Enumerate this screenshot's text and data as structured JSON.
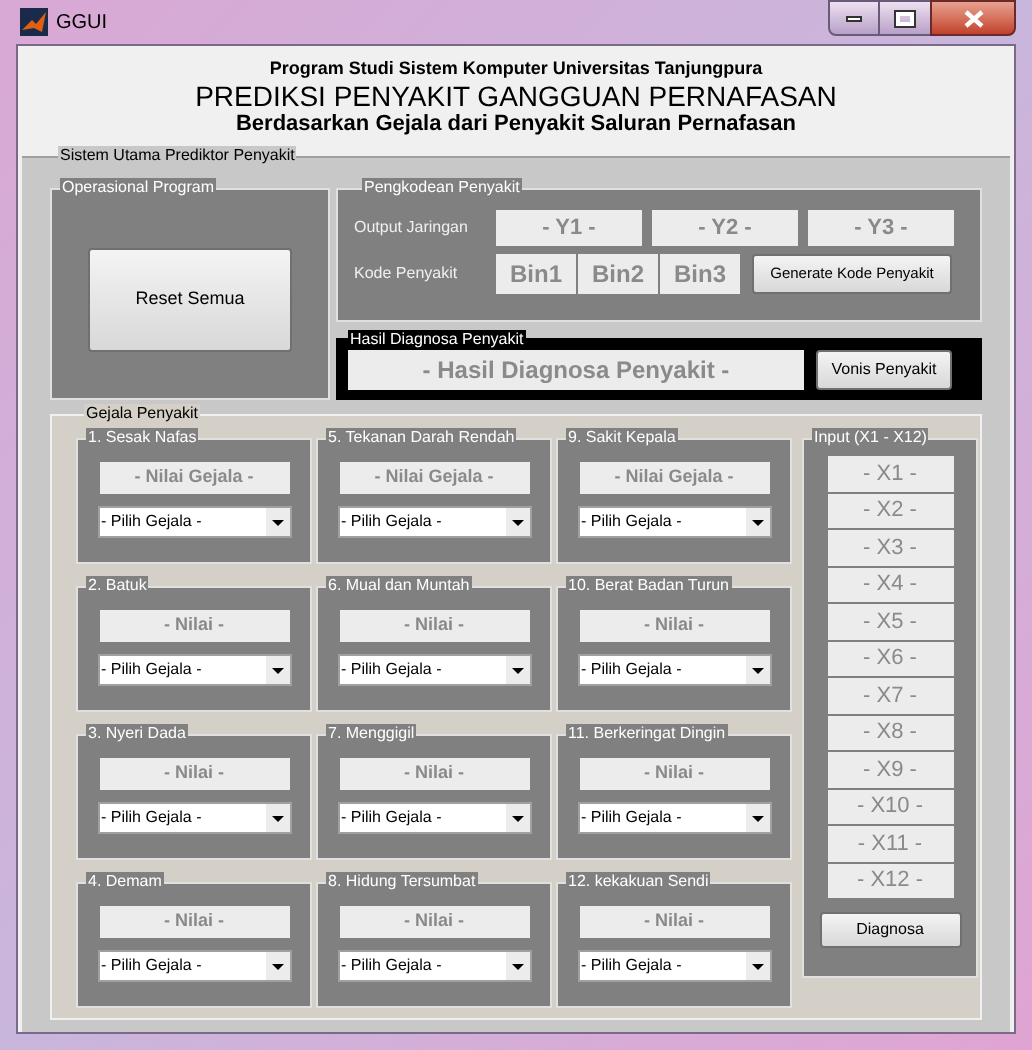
{
  "window": {
    "title": "GGUI"
  },
  "header": {
    "institution": "Program Studi Sistem Komputer Universitas Tanjungpura",
    "title": "PREDIKSI PENYAKIT GANGGUAN PERNAFASAN",
    "subtitle": "Berdasarkan Gejala dari Penyakit Saluran Pernafasan"
  },
  "main_panel": {
    "title": "Sistem Utama Prediktor Penyakit"
  },
  "operasional": {
    "title": "Operasional Program",
    "button": "Reset Semua"
  },
  "pengkodean": {
    "title": "Pengkodean Penyakit",
    "output_label": "Output Jaringan",
    "outputs": [
      "- Y1 -",
      "- Y2 -",
      "- Y3 -"
    ],
    "kode_label": "Kode Penyakit",
    "codes": [
      "Bin1",
      "Bin2",
      "Bin3"
    ],
    "button": "Generate Kode Penyakit"
  },
  "hasil": {
    "title": "Hasil Diagnosa Penyakit",
    "value": "- Hasil Diagnosa Penyakit -",
    "button": "Vonis Penyakit"
  },
  "gejala": {
    "title": "Gejala Penyakit",
    "symptoms": [
      {
        "title": "1. Sesak Nafas",
        "value": "- Nilai Gejala -",
        "dropdown": "- Pilih Gejala -"
      },
      {
        "title": "2. Batuk",
        "value": "- Nilai -",
        "dropdown": "- Pilih Gejala -"
      },
      {
        "title": "3. Nyeri Dada",
        "value": "- Nilai -",
        "dropdown": "- Pilih Gejala -"
      },
      {
        "title": "4. Demam",
        "value": "- Nilai -",
        "dropdown": "- Pilih Gejala -"
      },
      {
        "title": "5. Tekanan Darah Rendah",
        "value": "- Nilai Gejala -",
        "dropdown": "- Pilih Gejala -"
      },
      {
        "title": "6. Mual dan Muntah",
        "value": "- Nilai -",
        "dropdown": "- Pilih Gejala -"
      },
      {
        "title": "7. Menggigil",
        "value": "- Nilai -",
        "dropdown": "- Pilih Gejala -"
      },
      {
        "title": "8. Hidung Tersumbat",
        "value": "- Nilai -",
        "dropdown": "- Pilih Gejala -"
      },
      {
        "title": "9. Sakit Kepala",
        "value": "- Nilai Gejala -",
        "dropdown": "- Pilih Gejala -"
      },
      {
        "title": "10. Berat Badan Turun",
        "value": "- Nilai -",
        "dropdown": "- Pilih Gejala -"
      },
      {
        "title": "11. Berkeringat Dingin",
        "value": "- Nilai -",
        "dropdown": "- Pilih Gejala -"
      },
      {
        "title": "12. kekakuan Sendi",
        "value": "- Nilai -",
        "dropdown": "- Pilih Gejala -"
      }
    ],
    "input": {
      "title": "Input (X1 - X12)",
      "values": [
        "- X1 -",
        "- X2 -",
        "- X3 -",
        "- X4 -",
        "- X5 -",
        "- X6 -",
        "- X7 -",
        "- X8 -",
        "- X9 -",
        "- X10 -",
        "- X11 -",
        "- X12 -"
      ],
      "button": "Diagnosa"
    }
  }
}
